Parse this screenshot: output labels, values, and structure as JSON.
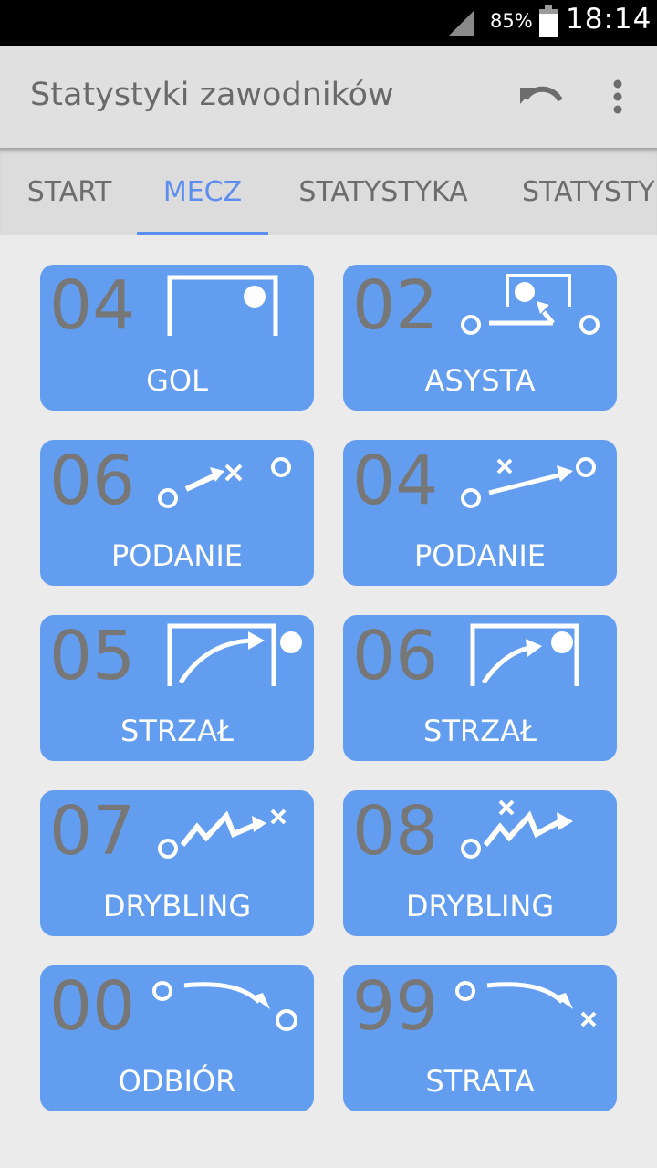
{
  "status_bar": {
    "battery": "85%",
    "time": "18:14"
  },
  "app_bar": {
    "title": "Statystyki zawodników",
    "icons": [
      "undo-icon",
      "more-vert-icon"
    ]
  },
  "tabs": [
    {
      "label": "START",
      "active": false
    },
    {
      "label": "MECZ",
      "active": true
    },
    {
      "label": "STATYSTYKA",
      "active": false
    },
    {
      "label": "STATYSTY",
      "active": false
    }
  ],
  "tiles": [
    {
      "count": "04",
      "label": "GOL",
      "icon": "goal-icon"
    },
    {
      "count": "02",
      "label": "ASYSTA",
      "icon": "assist-icon"
    },
    {
      "count": "06",
      "label": "PODANIE",
      "icon": "pass-failed-icon"
    },
    {
      "count": "04",
      "label": "PODANIE",
      "icon": "pass-success-icon"
    },
    {
      "count": "05",
      "label": "STRZAŁ",
      "icon": "shot-off-target-icon"
    },
    {
      "count": "06",
      "label": "STRZAŁ",
      "icon": "shot-on-target-icon"
    },
    {
      "count": "07",
      "label": "DRYBLING",
      "icon": "dribble-failed-icon"
    },
    {
      "count": "08",
      "label": "DRYBLING",
      "icon": "dribble-success-icon"
    },
    {
      "count": "00",
      "label": "ODBIÓR",
      "icon": "tackle-icon"
    },
    {
      "count": "99",
      "label": "STRATA",
      "icon": "ball-loss-icon"
    }
  ],
  "colors": {
    "tile": "#639df0",
    "accent": "#5b8eee",
    "count_text": "#777777"
  }
}
